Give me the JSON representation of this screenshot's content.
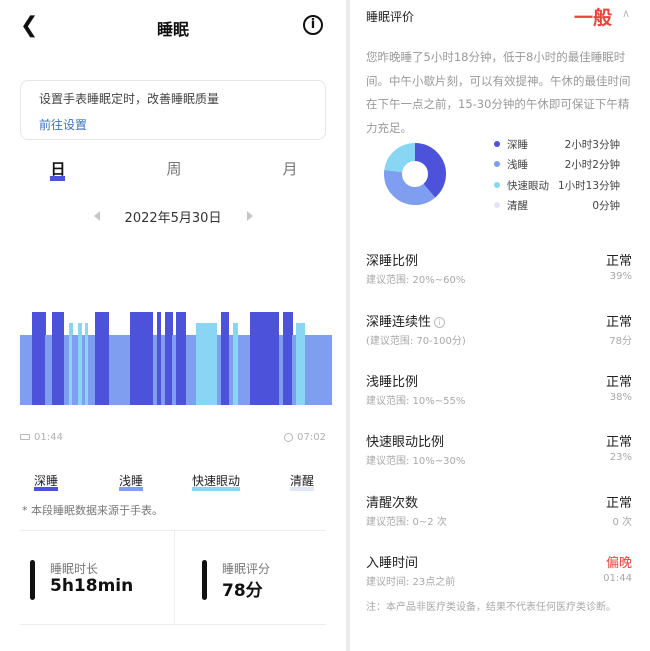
{
  "header": {
    "back_icon": "back-chevron-icon",
    "title": "睡眠",
    "info_icon": "info-icon"
  },
  "tip_card": {
    "text": "设置手表睡眠定时，改善睡眠质量",
    "link": "前往设置"
  },
  "tabs": [
    {
      "label": "日",
      "active": true
    },
    {
      "label": "周",
      "active": false
    },
    {
      "label": "月",
      "active": false
    }
  ],
  "date_nav": {
    "date": "2022年5月30日"
  },
  "sleep_timeline": {
    "start_time": "01:44",
    "end_time": "07:02",
    "stage_colors": {
      "deep": "#4c52d9",
      "light": "#7f9ef0",
      "rem": "#88d5f4",
      "awake": "#e1e6f4"
    },
    "segments": [
      {
        "stage": "light",
        "dur": 3.0
      },
      {
        "stage": "deep",
        "dur": 3.5
      },
      {
        "stage": "light",
        "dur": 1.8
      },
      {
        "stage": "deep",
        "dur": 3.0
      },
      {
        "stage": "light",
        "dur": 1.2
      },
      {
        "stage": "rem",
        "dur": 1.0
      },
      {
        "stage": "light",
        "dur": 1.5
      },
      {
        "stage": "rem",
        "dur": 1.0
      },
      {
        "stage": "light",
        "dur": 0.7
      },
      {
        "stage": "rem",
        "dur": 0.7
      },
      {
        "stage": "light",
        "dur": 2.0
      },
      {
        "stage": "deep",
        "dur": 3.5
      },
      {
        "stage": "light",
        "dur": 5.5
      },
      {
        "stage": "deep",
        "dur": 5.8
      },
      {
        "stage": "light",
        "dur": 1.0
      },
      {
        "stage": "deep",
        "dur": 1.0
      },
      {
        "stage": "light",
        "dur": 1.0
      },
      {
        "stage": "deep",
        "dur": 2.0
      },
      {
        "stage": "light",
        "dur": 1.0
      },
      {
        "stage": "deep",
        "dur": 2.5
      },
      {
        "stage": "light",
        "dur": 2.5
      },
      {
        "stage": "rem",
        "dur": 5.5
      },
      {
        "stage": "light",
        "dur": 1.0
      },
      {
        "stage": "deep",
        "dur": 2.0
      },
      {
        "stage": "light",
        "dur": 1.2
      },
      {
        "stage": "rem",
        "dur": 1.2
      },
      {
        "stage": "light",
        "dur": 3.0
      },
      {
        "stage": "deep",
        "dur": 7.5
      },
      {
        "stage": "light",
        "dur": 1.0
      },
      {
        "stage": "deep",
        "dur": 2.5
      },
      {
        "stage": "light",
        "dur": 1.0
      },
      {
        "stage": "rem",
        "dur": 2.2
      },
      {
        "stage": "light",
        "dur": 7.0
      }
    ]
  },
  "legend": [
    {
      "label": "深睡",
      "color": "#4c52d9"
    },
    {
      "label": "浅睡",
      "color": "#7f9ef0"
    },
    {
      "label": "快速眼动",
      "color": "#88d5f4"
    },
    {
      "label": "清醒",
      "color": "#e1e6f4"
    }
  ],
  "note": "* 本段睡眠数据来源于手表。",
  "stats": {
    "duration": {
      "label": "睡眠时长",
      "value": "5h18min"
    },
    "score": {
      "label": "睡眠评分",
      "value": "78分"
    }
  },
  "evaluation": {
    "title": "睡眠评价",
    "rating": "一般",
    "rating_color": "#e8453c",
    "collapse_icon": "chevron-up-icon",
    "paragraph": "您昨晚睡了5小时18分钟，低于8小时的最佳睡眠时间。中午小歇片刻，可以有效提神。午休的最佳时间在下午一点之前，15-30分钟的午休即可保证下午精力充足。"
  },
  "breakdown": [
    {
      "label": "深睡",
      "value": "2小时3分钟",
      "minutes": 123,
      "color": "#4c52d9"
    },
    {
      "label": "浅睡",
      "value": "2小时2分钟",
      "minutes": 122,
      "color": "#7f9ef0"
    },
    {
      "label": "快速眼动",
      "value": "1小时13分钟",
      "minutes": 73,
      "color": "#88d5f4"
    },
    {
      "label": "清醒",
      "value": "0分钟",
      "minutes": 0,
      "color": "#e1e6f4"
    }
  ],
  "metrics": [
    {
      "title": "深睡比例",
      "status": "正常",
      "range": "建议范围: 20%~60%",
      "value": "39%",
      "has_info": false
    },
    {
      "title": "深睡连续性",
      "status": "正常",
      "range": "(建议范围: 70-100分)",
      "value": "78分",
      "has_info": true
    },
    {
      "title": "浅睡比例",
      "status": "正常",
      "range": "建议范围: 10%~55%",
      "value": "38%",
      "has_info": false
    },
    {
      "title": "快速眼动比例",
      "status": "正常",
      "range": "建议范围: 10%~30%",
      "value": "23%",
      "has_info": false
    },
    {
      "title": "清醒次数",
      "status": "正常",
      "range": "建议范围: 0~2 次",
      "value": "0 次",
      "has_info": false
    },
    {
      "title": "入睡时间",
      "status": "偏晚",
      "status_color": "#e8453c",
      "range": "建议时间: 23点之前",
      "value": "01:44",
      "has_info": false
    }
  ],
  "footer": "注：本产品非医疗类设备，结果不代表任何医疗类诊断。"
}
